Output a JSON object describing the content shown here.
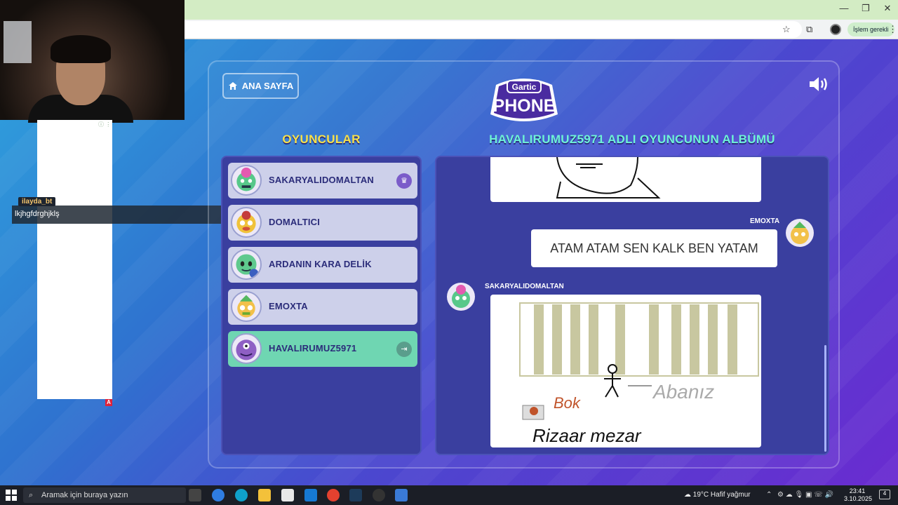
{
  "browser": {
    "window_controls": [
      "—",
      "❐",
      "✕"
    ],
    "action_button": "İşlem gerekli"
  },
  "stream_overlay": {
    "chat_username": "ilayda_bt",
    "chat_message": "lkjhgfdrghjklş",
    "chat_badge": "A"
  },
  "game": {
    "home_button": "ANA SAYFA",
    "logo_top": "Gartic",
    "logo_bottom": "PHONE",
    "players_title": "OYUNCULAR",
    "album_title": "HAVALIRUMUZ5971 ADLI OYUNCUNUN ALBÜMÜ",
    "players": [
      {
        "name": "SAKARYALIDOMALTAN",
        "badge": "crown-icon",
        "active": false
      },
      {
        "name": "DOMALTICI",
        "badge": "",
        "active": false
      },
      {
        "name": "ARDANIN KARA DELİK",
        "badge": "",
        "active": false
      },
      {
        "name": "EMOXTA",
        "badge": "",
        "active": false
      },
      {
        "name": "HAVALIRUMUZ5971",
        "badge": "exit-icon",
        "active": true
      }
    ],
    "album": {
      "guess_author": "EMOXTA",
      "guess_text": "ATAM ATAM SEN KALK BEN YATAM",
      "drawing_author": "SAKARYALIDOMALTAN",
      "drawing_texts": [
        "Abanız",
        "Bok",
        "Rizaar mezar"
      ]
    }
  },
  "taskbar": {
    "search_placeholder": "Aramak için buraya yazın",
    "weather_temp": "19°C",
    "weather_text": "Hafif yağmur",
    "time": "23:41",
    "date": "3.10.2025",
    "notification_count": "4"
  },
  "colors": {
    "players_title": "#f6e14a",
    "album_title": "#6ef3d7",
    "panel": "#3a3f9f",
    "active_row": "#6fd6b2"
  }
}
